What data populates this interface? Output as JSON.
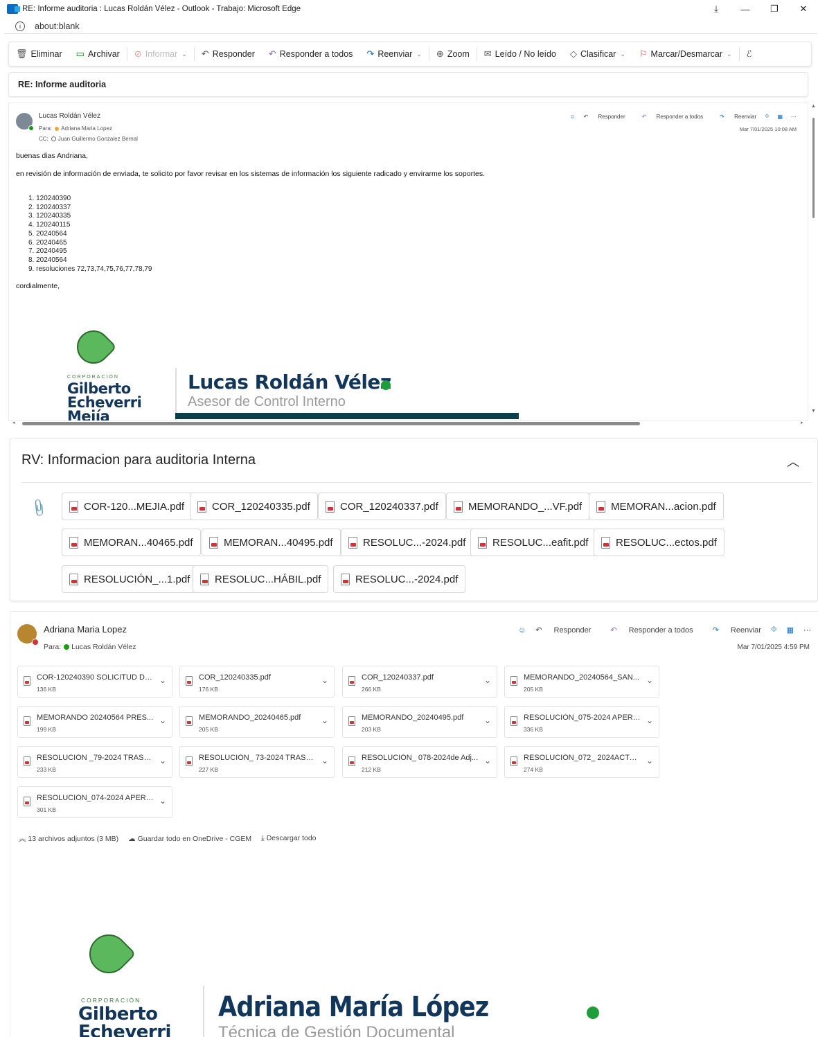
{
  "window": {
    "title": "RE: Informe auditoria : Lucas Roldán Vélez - Outlook - Trabajo: Microsoft Edge",
    "controls": {
      "download": "⤓",
      "minimize": "—",
      "restore": "❐",
      "close": "✕"
    }
  },
  "address_bar": {
    "url": "about:blank"
  },
  "toolbar": {
    "delete": "Eliminar",
    "archive": "Archivar",
    "report": "Informar",
    "reply": "Responder",
    "reply_all": "Responder a todos",
    "forward": "Reenviar",
    "zoom": "Zoom",
    "read_unread": "Leído / No leído",
    "categorize": "Clasificar",
    "flag": "Marcar/Desmarcar"
  },
  "message1": {
    "subject": "RE: Informe auditoria",
    "sender": "Lucas Roldán Vélez",
    "to_label": "Para:",
    "to": "Adriana Maria Lopez",
    "cc_label": "CC:",
    "cc": "Juan Guillermo Gonzalez Bernal",
    "actions": {
      "reply": "Responder",
      "reply_all": "Responder a todos",
      "forward": "Reenviar"
    },
    "date": "Mar 7/01/2025 10:08 AM",
    "greeting": "buenas dias Andriana,",
    "request": "en revisión de información de enviada, te solicito por favor revisar en los sistemas de información los siguiente radicado y envirarme los soportes.",
    "items": [
      "1. 120240390",
      "2. 120240337",
      "3. 120240335",
      "4. 120240115",
      "5. 20240564",
      "6. 20240465",
      "7. 20240495",
      "8. 20240564",
      "9. resoluciones 72,73,74,75,76,77,78,79"
    ],
    "closing": "cordialmente,",
    "logo": {
      "small": "CORPORACIÓN",
      "line1": "Gilberto",
      "line2": "Echeverri",
      "line3": "Mejía"
    },
    "signature": {
      "name": "Lucas Roldán Vélez",
      "role": "Asesor de Control Interno"
    }
  },
  "thread2": {
    "subject": "RV: Informacion para auditoria Interna",
    "chips": [
      "COR-120...MEJIA.pdf",
      "COR_120240335.pdf",
      "COR_120240337.pdf",
      "MEMORANDO_...VF.pdf",
      "MEMORAN...acion.pdf",
      "MEMORAN...40465.pdf",
      "MEMORAN...40495.pdf",
      "RESOLUC...-2024.pdf",
      "RESOLUC...eafit.pdf",
      "RESOLUC...ectos.pdf",
      "RESOLUCIÓN_...1.pdf",
      "RESOLUC...HÁBIL.pdf",
      "RESOLUC...-2024.pdf"
    ]
  },
  "message3": {
    "sender": "Adriana Maria Lopez",
    "to_label": "Para:",
    "to": "Lucas Roldán Vélez",
    "actions": {
      "reply": "Responder",
      "reply_all": "Responder a todos",
      "forward": "Reenviar"
    },
    "date": "Mar 7/01/2025 4:59 PM",
    "attachments": [
      {
        "name": "COR-120240390 SOLICITUD DE...",
        "size": "136 KB"
      },
      {
        "name": "COR_120240335.pdf",
        "size": "176 KB"
      },
      {
        "name": "COR_120240337.pdf",
        "size": "266 KB"
      },
      {
        "name": "MEMORANDO_20240564_SAN...",
        "size": "205 KB"
      },
      {
        "name": "MEMORANDO 20240564 PRES...",
        "size": "199 KB"
      },
      {
        "name": "MEMORANDO_20240465.pdf",
        "size": "205 KB"
      },
      {
        "name": "MEMORANDO_20240495.pdf",
        "size": "203 KB"
      },
      {
        "name": "RESOLUCIÓN_075-2024 APERT...",
        "size": "336 KB"
      },
      {
        "name": "RESOLUCIÓN _79-2024 TRASLA...",
        "size": "233 KB"
      },
      {
        "name": "RESOLUCIÓN_ 73-2024 TRASLA...",
        "size": "227 KB"
      },
      {
        "name": "RESOLUCIÓN_ 078-2024de Adj...",
        "size": "212 KB"
      },
      {
        "name": "RESOLUCIÓN_072_ 2024ACTO ...",
        "size": "274 KB"
      },
      {
        "name": "RESOLUCIÓN_074-2024 APERT...",
        "size": "301 KB"
      }
    ],
    "footer": {
      "count": "13 archivos adjuntos (3 MB)",
      "save_all": "Guardar todo en OneDrive - CGEM",
      "download_all": "Descargar todo"
    },
    "logo": {
      "small": "CORPORACIÓN",
      "line1": "Gilberto",
      "line2": "Echeverri"
    },
    "signature": {
      "name": "Adriana María López",
      "role": "Técnica de Gestión Documental"
    }
  },
  "colors": {
    "accent": "#0f6cbd",
    "brand_navy": "#12355a",
    "brand_green": "#1e9e3a",
    "flag_red": "#d13438"
  }
}
